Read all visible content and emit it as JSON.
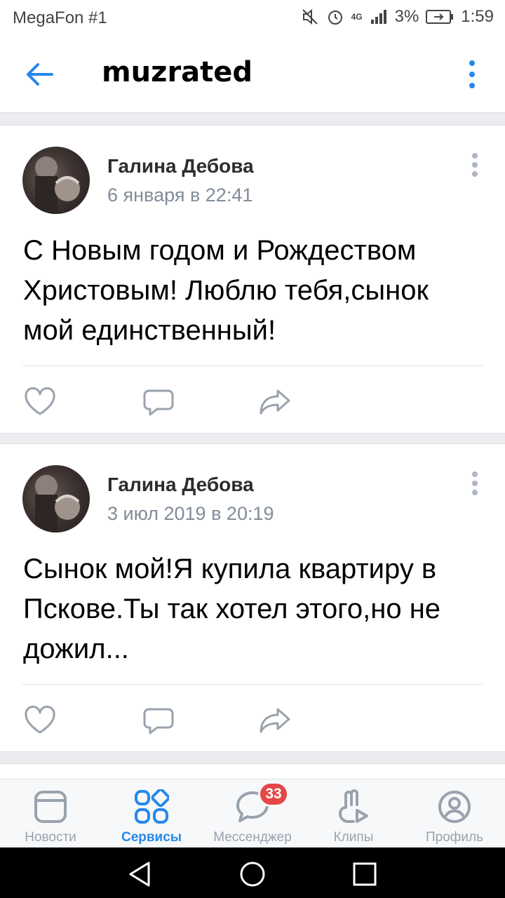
{
  "status_bar": {
    "carrier": "MegaFon #1",
    "network": "4G",
    "battery": "3%",
    "time": "1:59"
  },
  "header": {
    "title": "muzrated"
  },
  "posts": [
    {
      "author": "Галина Дебова",
      "date": "6 января в 22:41",
      "text": "С Новым годом и Рождеством Христовым! Люблю тебя,сынок мой единственный!"
    },
    {
      "author": "Галина Дебова",
      "date": "3 июл 2019 в 20:19",
      "text": "Сынок мой!Я купила квартиру в Пскове.Ты так хотел этого,но не дожил..."
    }
  ],
  "tabs": [
    {
      "label": "Новости",
      "icon": "news-icon"
    },
    {
      "label": "Сервисы",
      "icon": "services-icon",
      "active": true
    },
    {
      "label": "Мессенджер",
      "icon": "messenger-icon",
      "badge": "33"
    },
    {
      "label": "Клипы",
      "icon": "clips-icon"
    },
    {
      "label": "Профиль",
      "icon": "profile-icon"
    }
  ],
  "colors": {
    "accent": "#2688eb",
    "text_secondary": "#818c99",
    "badge": "#e64646",
    "icon_gray": "#99a2ad"
  }
}
